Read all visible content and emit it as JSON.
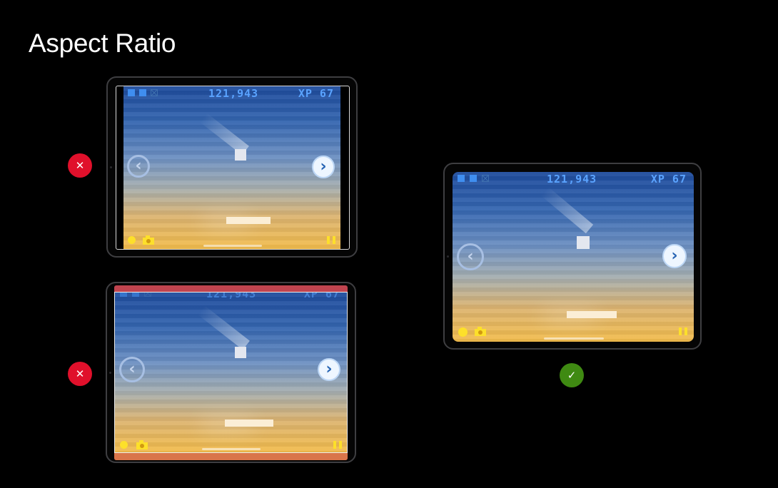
{
  "slide": {
    "title": "Aspect Ratio"
  },
  "game": {
    "score": "121,943",
    "xp": "XP 67"
  },
  "icons": {
    "life": "square-block-icon",
    "life_lost": "x-block-icon",
    "left_arrow": "chevron-left-circle-icon",
    "right_arrow": "chevron-right-circle-icon",
    "coin": "coin-icon",
    "camera": "camera-icon",
    "pause": "pause-icon"
  },
  "examples": [
    {
      "id": "pillarbox",
      "verdict": "incorrect",
      "verdict_glyph": "✕"
    },
    {
      "id": "stretched",
      "verdict": "incorrect",
      "verdict_glyph": "✕"
    },
    {
      "id": "native",
      "verdict": "correct",
      "verdict_glyph": "✓"
    }
  ],
  "glyphs": {
    "left_arrow": "‹",
    "right_arrow": "›"
  },
  "colors": {
    "incorrect": "#e0102b",
    "correct": "#3f8a12",
    "score_text": "#5aa3ff",
    "hud_yellow": "#fde02a"
  }
}
